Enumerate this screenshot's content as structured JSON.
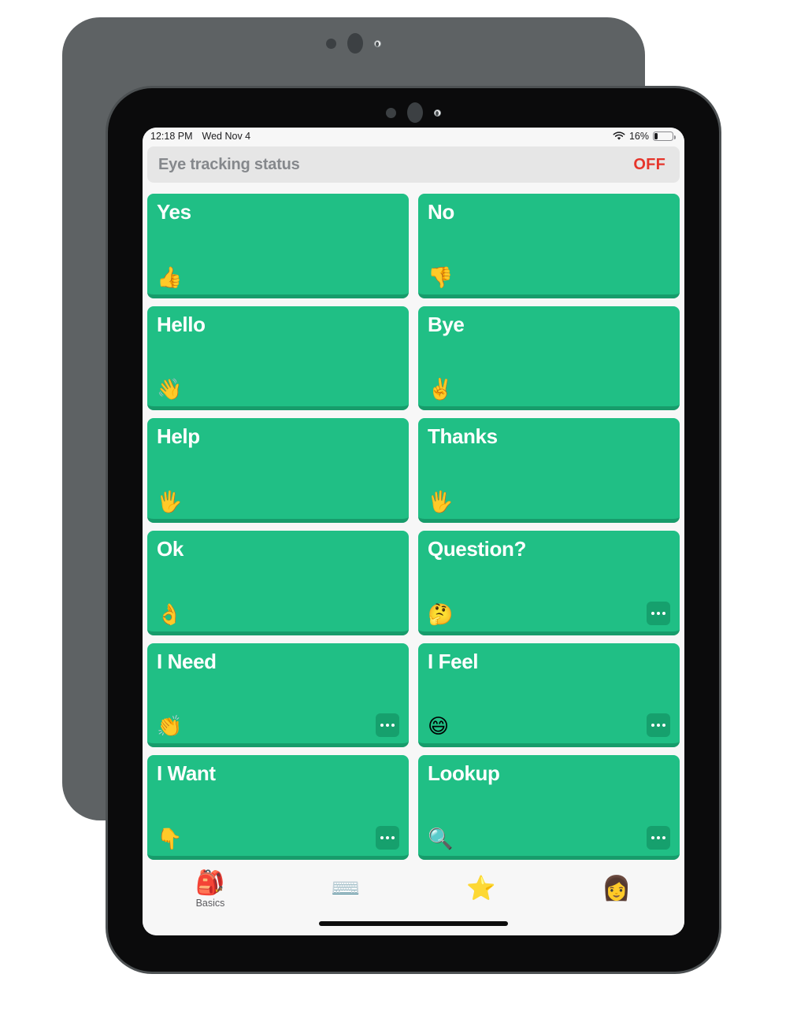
{
  "device": {
    "back_frame_color": "#5e6264",
    "front_frame_color": "#0b0b0c",
    "camera_icons": [
      "camera-dot-small",
      "camera-dot-large",
      "camera-flash"
    ]
  },
  "status_bar": {
    "time": "12:18 PM",
    "date": "Wed Nov 4",
    "wifi_icon": "wifi-icon",
    "battery_percent": "16%",
    "battery_icon": "battery-icon",
    "battery_level": 16
  },
  "eye_header": {
    "title": "Eye tracking status",
    "status": "OFF",
    "status_color": "#e6352b",
    "background": "#e6e6e6"
  },
  "theme": {
    "card_green": "#20bf85",
    "card_green_dark": "#179c6b",
    "badge_green": "#16a06d",
    "screen_background": "#f7f7f7"
  },
  "cards": [
    {
      "label": "Yes",
      "emoji": "👍",
      "emoji_name": "thumbs-up-icon",
      "has_more": false
    },
    {
      "label": "No",
      "emoji": "👎",
      "emoji_name": "thumbs-down-icon",
      "has_more": false
    },
    {
      "label": "Hello",
      "emoji": "👋",
      "emoji_name": "waving-hand-icon",
      "has_more": false
    },
    {
      "label": "Bye",
      "emoji": "✌️",
      "emoji_name": "victory-hand-icon",
      "has_more": false
    },
    {
      "label": "Help",
      "emoji": "🖐️",
      "emoji_name": "raised-hand-icon",
      "has_more": false
    },
    {
      "label": "Thanks",
      "emoji": "🖐️",
      "emoji_name": "raised-hand-icon",
      "has_more": false
    },
    {
      "label": "Ok",
      "emoji": "👌",
      "emoji_name": "ok-hand-icon",
      "has_more": false
    },
    {
      "label": "Question?",
      "emoji": "🤔",
      "emoji_name": "thinking-face-icon",
      "has_more": true
    },
    {
      "label": "I Need",
      "emoji": "👏",
      "emoji_name": "clapping-hands-icon",
      "has_more": true
    },
    {
      "label": "I Feel",
      "emoji": "😄",
      "emoji_name": "grinning-face-icon",
      "has_more": true
    },
    {
      "label": "I Want",
      "emoji": "👇",
      "emoji_name": "pointing-down-icon",
      "has_more": true
    },
    {
      "label": "Lookup",
      "emoji": "🔍",
      "emoji_name": "magnifying-glass-icon",
      "has_more": true
    }
  ],
  "tabbar": {
    "tabs": [
      {
        "icon": "🎒",
        "icon_name": "backpack-icon",
        "label": "Basics"
      },
      {
        "icon": "⌨️",
        "icon_name": "keyboard-icon",
        "label": ""
      },
      {
        "icon": "⭐",
        "icon_name": "star-icon",
        "label": ""
      },
      {
        "icon": "👩",
        "icon_name": "woman-icon",
        "label": ""
      }
    ]
  }
}
